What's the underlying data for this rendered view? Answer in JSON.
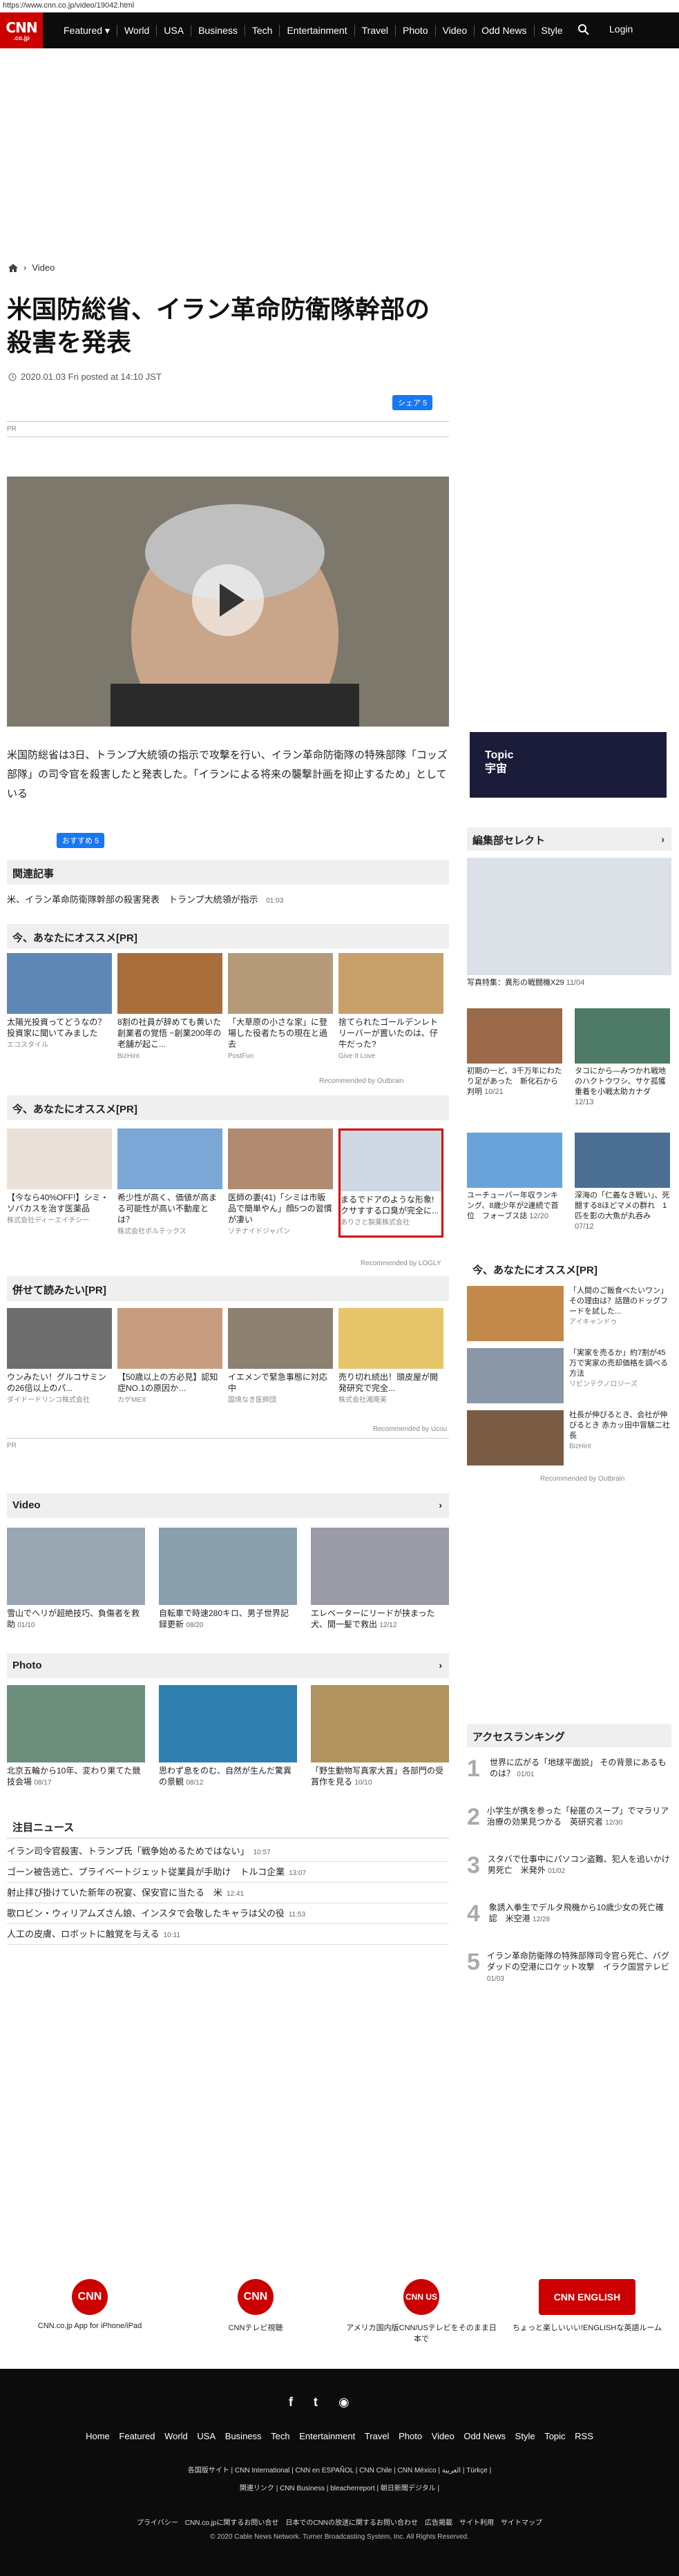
{
  "url": "https://www.cnn.co.jp/video/19042.html",
  "nav": {
    "logo_main": "CNN",
    "logo_sub": ".co.jp",
    "items": [
      "Featured ▾",
      "World",
      "USA",
      "Business",
      "Tech",
      "Entertainment",
      "Travel",
      "Photo",
      "Video",
      "Odd News",
      "Style"
    ],
    "login": "Login"
  },
  "breadcrumb": {
    "section": "Video"
  },
  "article": {
    "title": "米国防総省、イラン革命防衛隊幹部の殺害を発表",
    "date": "2020.01.03 Fri posted at 14:10 JST",
    "share": "シェア 5",
    "pr": "PR",
    "body": "米国防総省は3日、トランプ大統領の指示で攻撃を行い、イラン革命防衛隊の特殊部隊「コッズ部隊」の司令官を殺害したと発表した。「イランによる将来の襲撃計画を抑止するため」としている",
    "recommend": "おすすめ 5"
  },
  "related": {
    "heading": "関連記事",
    "items": [
      {
        "text": "米、イラン革命防衛隊幹部の殺害発表　トランプ大統領が指示",
        "time": "01:03"
      }
    ]
  },
  "rec1": {
    "heading": "今、あなたにオススメ[PR]",
    "cards": [
      {
        "text": "太陽光投資ってどうなの？投資家に聞いてみました",
        "src": "エコスタイル"
      },
      {
        "text": "8割の社員が辞めても黄いた創業者の覚悟 ~創業200年の老舗が起こ...",
        "src": "BizHint"
      },
      {
        "text": "「大草原の小さな家」に登場した役者たちの現在と過去",
        "src": "PostFun"
      },
      {
        "text": "捨てられたゴールデンレトリーバーが置いたのは、仔牛だった?",
        "src": "Give It Love"
      }
    ],
    "by": "Recommended by Outbrain"
  },
  "rec2": {
    "heading": "今、あなたにオススメ[PR]",
    "cards": [
      {
        "text": "【今なら40%OFF!】シミ・ソバカスを治す医薬品",
        "src": "株式会社ディーエイチシー"
      },
      {
        "text": "希少性が高く、価値が高まる可能性が高い不動産とは？",
        "src": "株式会社ボルテックス"
      },
      {
        "text": "医師の妻(41)「シミは市販品で簡単やん」顔5つの習慣が凄い",
        "src": "ソチナイドジャパン"
      },
      {
        "text": "まるでドアのような形象!クサすする口臭が完全に...",
        "src": "ありさと製薬株式会社"
      }
    ],
    "by": "Recommended by LOGLY"
  },
  "rec3": {
    "heading": "併せて読みたい[PR]",
    "cards": [
      {
        "text": "ウンみたい！グルコサミンの26倍以上のパ...",
        "src": "ダイドードリンコ株式会社"
      },
      {
        "text": "【50歳以上の方必見】認知症NO.1の原因か…",
        "src": "カゲMEX"
      },
      {
        "text": "イエメンで緊急事態に対応中",
        "src": "国境なき医師団"
      },
      {
        "text": "売り切れ続出！頭皮屋が開発研究で完全...",
        "src": "株式会社湘南美"
      }
    ],
    "by": "Recommended by Ucou",
    "pr": "PR"
  },
  "video_section": {
    "heading": "Video",
    "cards": [
      {
        "text": "雪山でヘリが超絶技巧、負傷者を救助",
        "time": "01/10"
      },
      {
        "text": "自転車で時速280キロ、男子世界記録更新",
        "time": "08/20"
      },
      {
        "text": "エレベーターにリードが挟まった犬、間一髪で救出",
        "time": "12/12"
      }
    ]
  },
  "photo_section": {
    "heading": "Photo",
    "cards": [
      {
        "text": "北京五輪から10年、変わり果てた競技会場",
        "time": "08/17"
      },
      {
        "text": "思わず息をのむ、自然が生んだ驚異の景観",
        "time": "08/12"
      },
      {
        "text": "「野生動物写真家大賞」各部門の受賞作を見る",
        "time": "10/10"
      }
    ]
  },
  "news": {
    "heading": "注目ニュース",
    "items": [
      {
        "text": "イラン司令官殺害、トランプ氏「戦争始めるためではない」",
        "time": "10:57"
      },
      {
        "text": "ゴーン被告逃亡、プライベートジェット従業員が手助け　トルコ企業",
        "time": "13:07"
      },
      {
        "text": "射止拝び掛けていた新年の祝宴、保安官に当たる　米",
        "time": "12:41"
      },
      {
        "text": "歌ロビン・ウィリアムズさん娘、インスタで会敬したキャラは父の役",
        "time": "11:53"
      },
      {
        "text": "人工の皮膚、ロボットに触覚を与える",
        "time": "10:11"
      }
    ]
  },
  "sidebar": {
    "ad_text": "Topic 宇宙",
    "editor_heading": "編集部セレクト",
    "hero_text": "写真特集：異形の戦闘機X29",
    "hero_time": "11/04",
    "cards": [
      {
        "text": "初期の一ど、3千万年にわたり足があった　新化石から判明",
        "time": "10/21"
      },
      {
        "text": "タコにから—みつかれ戦地のハクトウワシ、サケ孤獲重着を小戦太助カナダ",
        "time": "12/13"
      },
      {
        "text": "ユーチューバー年収ランキング、8歳少年が2連続で首位　フォーブス誌",
        "time": "12/20"
      },
      {
        "text": "深海の「仁義なき戦い」、死闘する8ほどマメの群れ　1匹を影の大魚が丸呑み",
        "time": "07/12"
      }
    ],
    "rec_heading": "今、あなたにオススメ[PR]",
    "rec_items": [
      {
        "text": "「人間のご飯食べたいワン」その理由は？話題のドッグフードを試した...",
        "src": "アイキャンドゥ"
      },
      {
        "text": "「実家を売るか」約7割が45万で実家の売却価格を調べる方法",
        "src": "リビンテクノロジーズ"
      },
      {
        "text": "社長が伸びるとき、会社が伸びるとき 赤カッ田中冒験二社長",
        "src": "BizHint"
      }
    ],
    "rec_by": "Recommended by Outbrain",
    "rank_heading": "アクセスランキング",
    "rank": [
      {
        "n": "1",
        "text": "世界に広がる「地球平面説」 その背景にあるものは？",
        "time": "01/01"
      },
      {
        "n": "2",
        "text": "小学生が携を参った「秘匿のスープ」でマラリア治療の効果見つかる　英研究者",
        "time": "12/30"
      },
      {
        "n": "3",
        "text": "スタバで仕事中にパソコン盗難、犯人を追いかけ男死亡　米発外",
        "time": "01/02"
      },
      {
        "n": "4",
        "text": "象誘入拳生でデルタ飛機から10歳少女の死亡確認　米空港",
        "time": "12/28"
      },
      {
        "n": "5",
        "text": "イラン革命防衛隊の特殊部隊司令官ら死亡、バグダッドの空港にロケット攻撃　イラク国営テレビ",
        "time": "01/03"
      }
    ]
  },
  "apps": [
    {
      "icon": "CNN",
      "text": "CNN.co.jp App for iPhone/iPad"
    },
    {
      "icon": "CNN",
      "text": "CNNテレビ視聴"
    },
    {
      "icon": "CNN US",
      "text": "アメリカ国内版CNN/USテレビをそのまま日本で"
    },
    {
      "icon": "CNN ENGLISH",
      "text": "ちょっと楽しいいい!ENGLISHな英語ルーム"
    }
  ],
  "footer": {
    "links": [
      "Home",
      "Featured",
      "World",
      "USA",
      "Business",
      "Tech",
      "Entertainment",
      "Travel",
      "Photo",
      "Video",
      "Odd News",
      "Style",
      "Topic",
      "RSS"
    ],
    "sites1": "各国版サイト | CNN International | CNN en ESPAÑOL | CNN Chile | CNN México | العربية | Türkçe |",
    "sites2": "関連リンク | CNN Business | bleacherreport | 朝日新聞デジタル |",
    "sites3": "プライバシー　CNN.co.jpに関するお問い合せ　日本でのCNNの放送に関するお問い合わせ　広告掲載　サイト利用　サイトマップ",
    "copyright": "© 2020 Cable News Network.  Turner Broadcasting System, Inc.  All Rights Reserved."
  }
}
